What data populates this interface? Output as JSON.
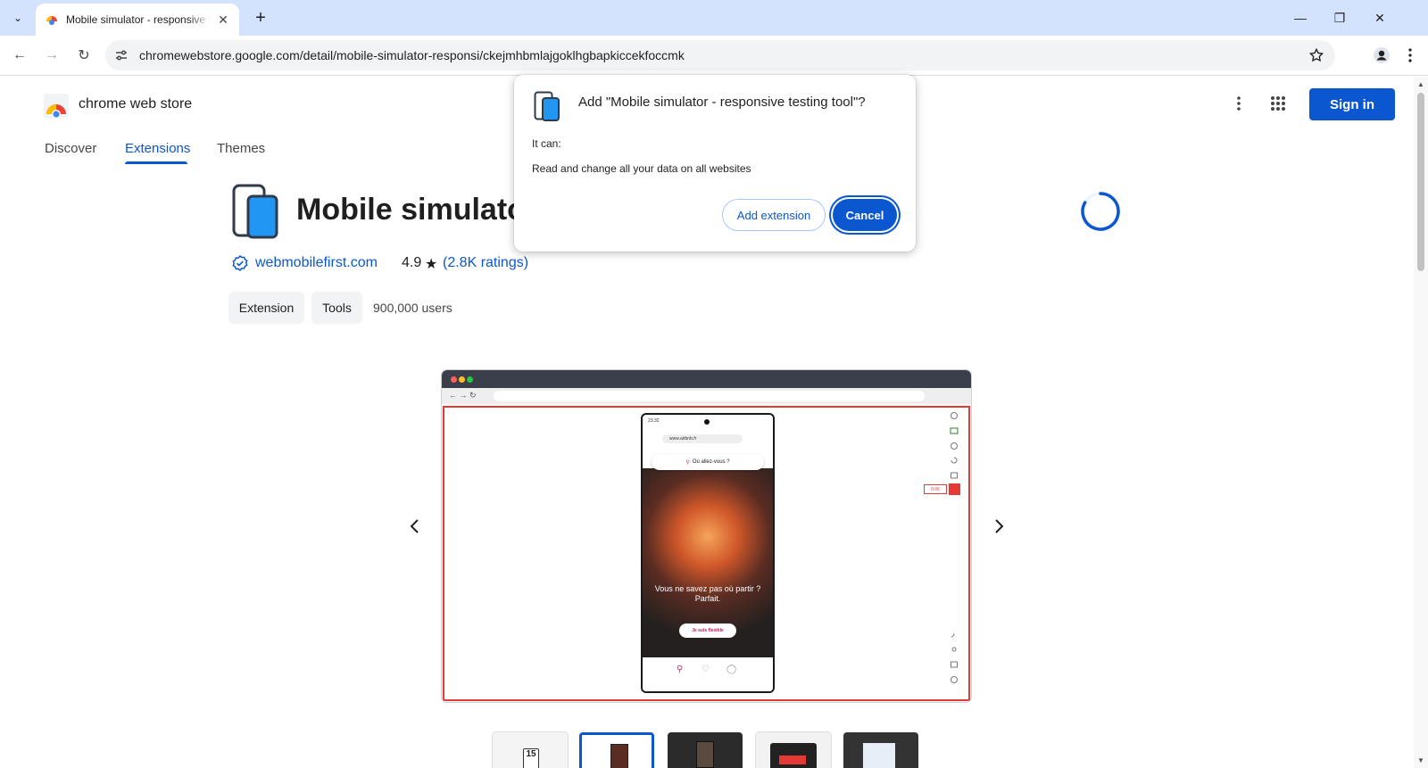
{
  "browser": {
    "tab_title": "Mobile simulator - responsive testing tool",
    "url": "chromewebstore.google.com/detail/mobile-simulator-responsi/ckejmhbmlajgoklhgbapkiccekfoccmk"
  },
  "store": {
    "name": "chrome web store",
    "sign_in": "Sign in",
    "nav": [
      "Discover",
      "Extensions",
      "Themes"
    ]
  },
  "extension": {
    "title": "Mobile simulato",
    "publisher": "webmobilefirst.com",
    "rating": "4.9",
    "ratings_link": "(2.8K ratings)",
    "chips": [
      "Extension",
      "Tools"
    ],
    "users": "900,000 users"
  },
  "screenshot": {
    "search": "Où allez-vous ?",
    "headline": "Vous ne savez pas où partir ? Parfait.",
    "button": "Je suis flexible",
    "status": "23:32",
    "phone_url": "www.airbnb.fr",
    "rec_time": "0:06"
  },
  "dialog": {
    "title": "Add \"Mobile simulator - responsive testing tool\"?",
    "it_can": "It can:",
    "permission": "Read and change all your data on all websites",
    "add_label": "Add extension",
    "cancel_label": "Cancel"
  },
  "colors": {
    "accent": "#0b57d0",
    "tabstrip": "#d3e3fd"
  }
}
